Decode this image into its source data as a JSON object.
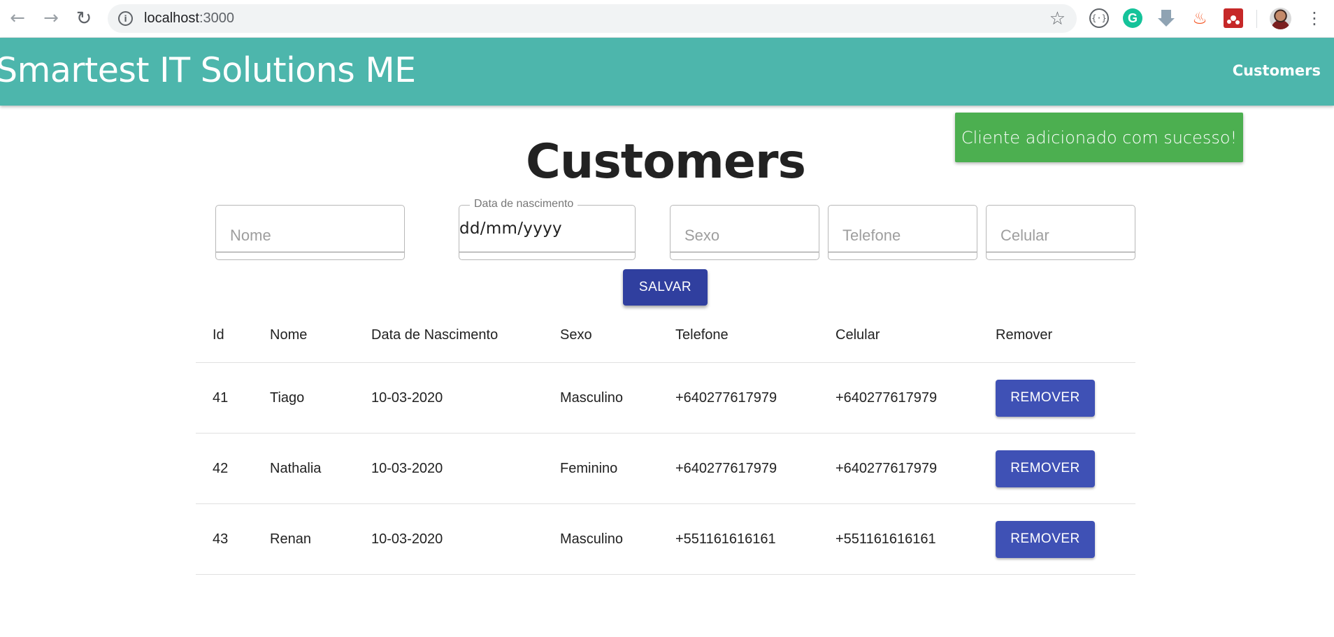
{
  "browser": {
    "url_host": "localhost",
    "url_port": ":3000",
    "icons": [
      "back-icon",
      "forward-icon",
      "reload-icon",
      "info-icon",
      "star-icon",
      "kebab-menu-icon"
    ]
  },
  "header": {
    "brand": "Smartest IT Solutions ME",
    "nav_link": "Customers",
    "color": "#4db6ac"
  },
  "toast": {
    "message": "Cliente adicionado com sucesso!",
    "color": "#4caf50"
  },
  "main": {
    "title": "Customers"
  },
  "form": {
    "nome_placeholder": "Nome",
    "data_label": "Data de nascimento",
    "data_value": "dd/mm/yyyy",
    "sexo_placeholder": "Sexo",
    "telefone_placeholder": "Telefone",
    "celular_placeholder": "Celular",
    "save_label": "SALVAR"
  },
  "table": {
    "headers": [
      "Id",
      "Nome",
      "Data de Nascimento",
      "Sexo",
      "Telefone",
      "Celular",
      "Remover"
    ],
    "rows": [
      {
        "id": "41",
        "nome": "Tiago",
        "data": "10-03-2020",
        "sexo": "Masculino",
        "telefone": "+640277617979",
        "celular": "+640277617979",
        "remove_label": "REMOVER"
      },
      {
        "id": "42",
        "nome": "Nathalia",
        "data": "10-03-2020",
        "sexo": "Feminino",
        "telefone": "+640277617979",
        "celular": "+640277617979",
        "remove_label": "REMOVER"
      },
      {
        "id": "43",
        "nome": "Renan",
        "data": "10-03-2020",
        "sexo": "Masculino",
        "telefone": "+551161616161",
        "celular": "+551161616161",
        "remove_label": "REMOVER"
      }
    ]
  },
  "colors": {
    "primary_button": "#303f9f",
    "remove_button": "#3f51b5"
  }
}
